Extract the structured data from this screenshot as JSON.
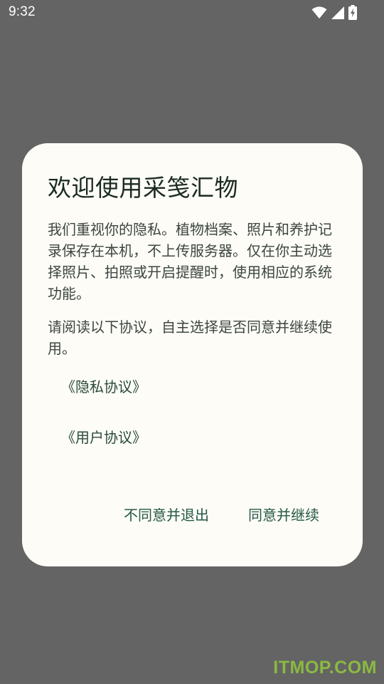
{
  "status_bar": {
    "time": "9:32",
    "icons": [
      "wifi-icon",
      "cell-signal-icon",
      "battery-charging-icon"
    ]
  },
  "dialog": {
    "title": "欢迎使用采笺汇物",
    "paragraph_1": "我们重视你的隐私。植物档案、照片和养护记录保存在本机，不上传服务器。仅在你主动选择照片、拍照或开启提醒时，使用相应的系统功能。",
    "paragraph_2": "请阅读以下协议，自主选择是否同意并继续使用。",
    "links": {
      "privacy": "《隐私协议》",
      "user": "《用户协议》"
    },
    "actions": {
      "decline": "不同意并退出",
      "accept": "同意并继续"
    }
  },
  "watermark": "ITMOP.COM",
  "colors": {
    "scrim": "#646464",
    "dialog_bg": "#fdfcf7",
    "accent": "#255845",
    "watermark": "#8dbf40"
  }
}
